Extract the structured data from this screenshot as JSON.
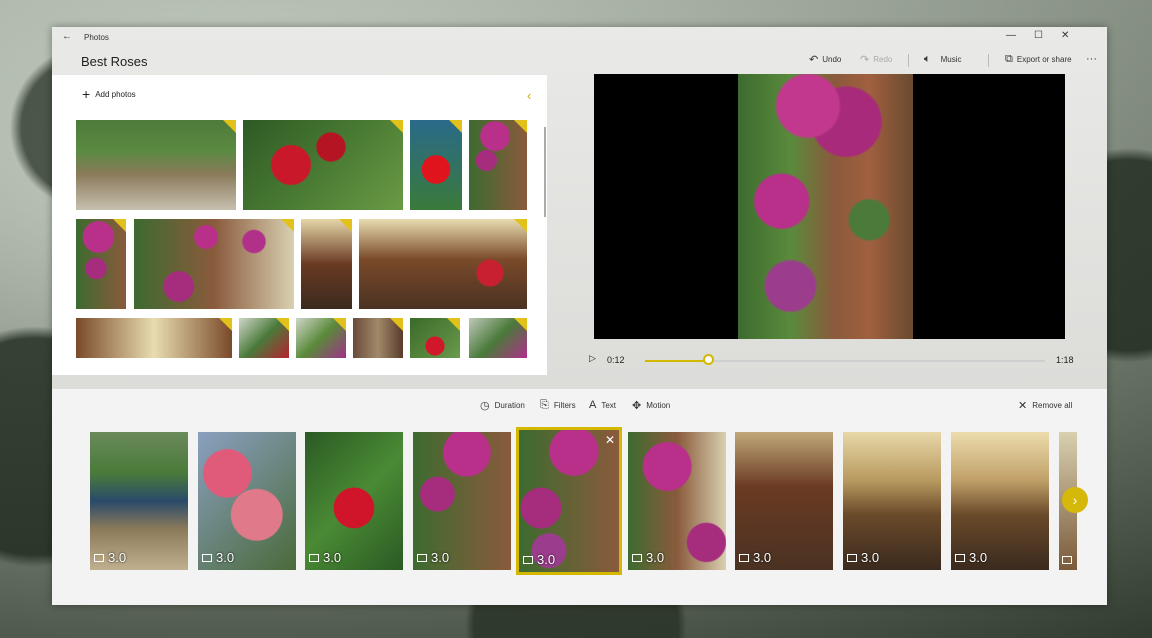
{
  "app": {
    "name": "Photos",
    "project_title": "Best Roses"
  },
  "toolbar": {
    "undo": "Undo",
    "redo": "Redo",
    "music": "Music",
    "export": "Export or share",
    "more": "···"
  },
  "library": {
    "add_photos": "Add photos"
  },
  "playback": {
    "current": "0:12",
    "total": "1:18",
    "progress_fraction": 0.16
  },
  "story_tools": {
    "duration": "Duration",
    "filters": "Filters",
    "text": "Text",
    "motion": "Motion",
    "remove_all": "Remove all"
  },
  "storyboard": {
    "cards": [
      {
        "duration": "3.0"
      },
      {
        "duration": "3.0"
      },
      {
        "duration": "3.0"
      },
      {
        "duration": "3.0"
      },
      {
        "duration": "3.0",
        "selected": true
      },
      {
        "duration": "3.0"
      },
      {
        "duration": "3.0"
      },
      {
        "duration": "3.0"
      },
      {
        "duration": "3.0"
      }
    ]
  },
  "colors": {
    "accent": "#d4b800",
    "window": "#f3f3f3"
  }
}
